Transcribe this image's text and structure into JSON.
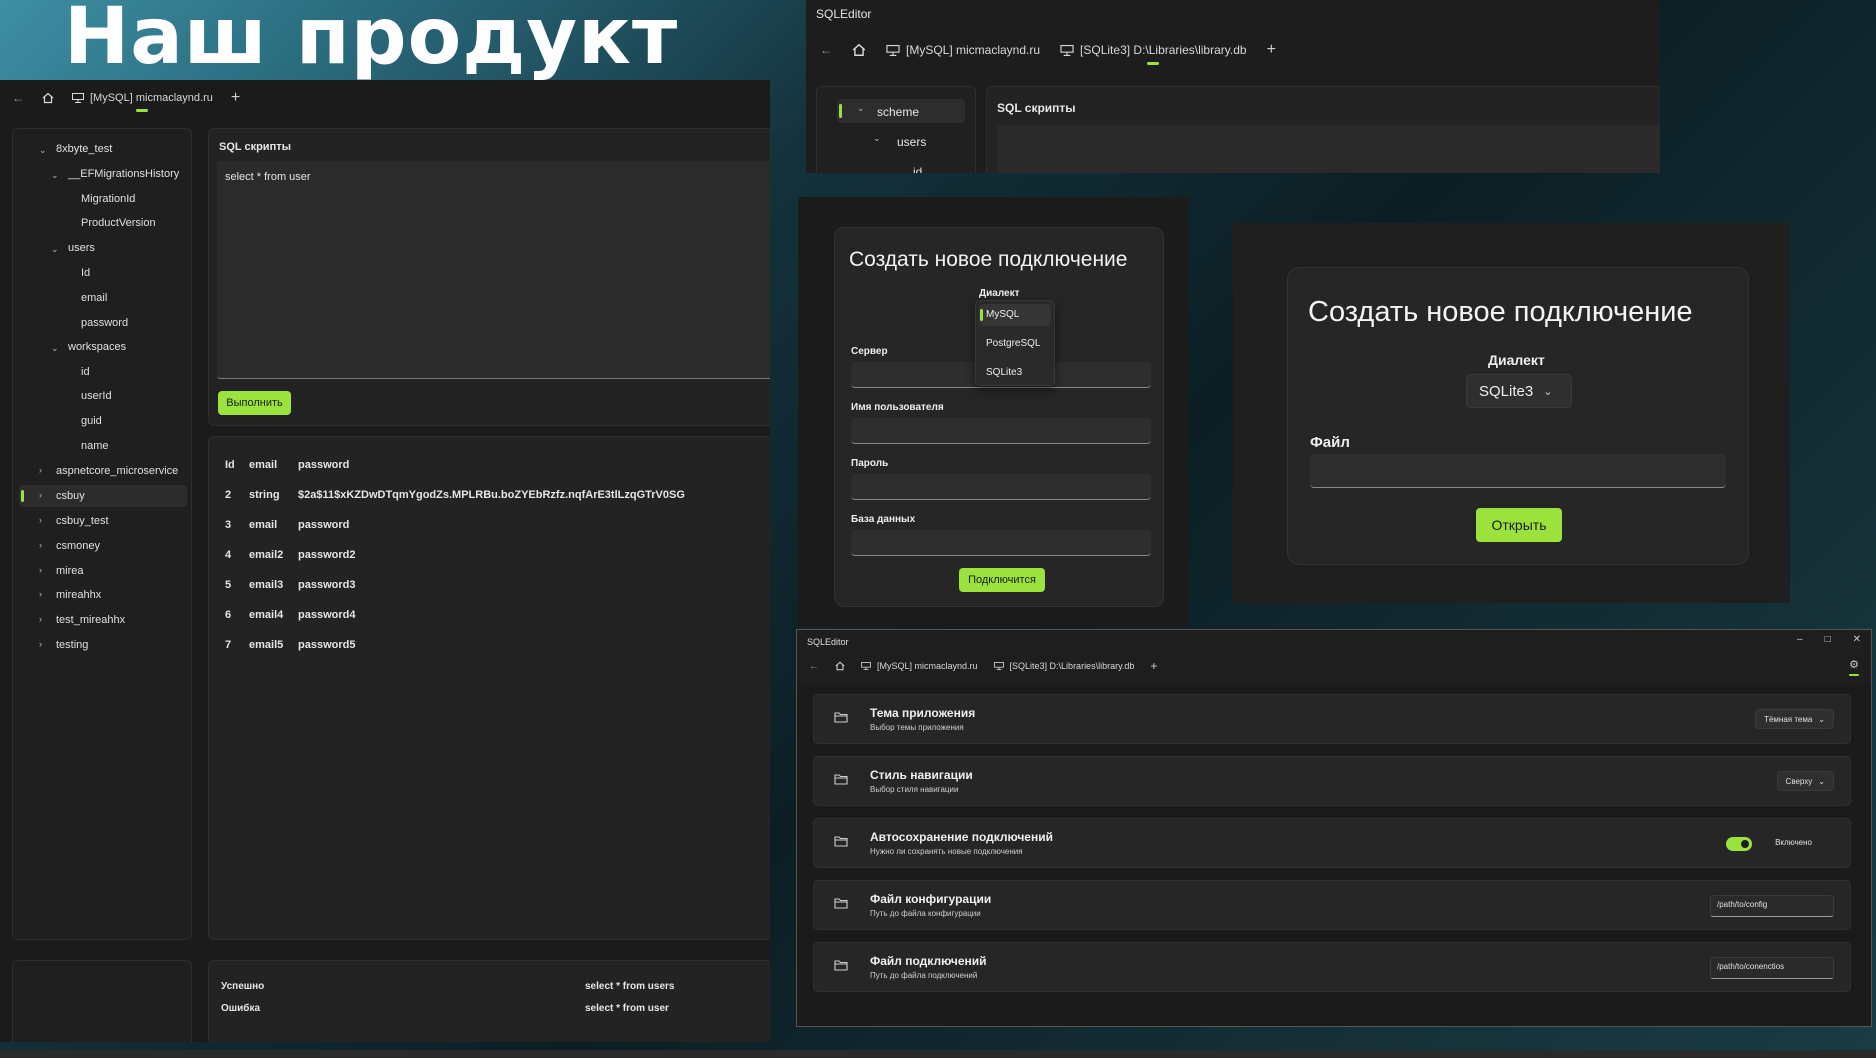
{
  "headline": "Наш продукт",
  "colors": {
    "accent": "#9be33c",
    "window_bg": "#1c1c1c",
    "panel_bg": "#232323"
  },
  "main_window": {
    "tabs": [
      {
        "label": "[MySQL] micmaclaynd.ru",
        "icon": "server-icon"
      }
    ],
    "tree": {
      "db1": "8xbyte_test",
      "t1": "__EFMigrationsHistory",
      "t1c1": "MigrationId",
      "t1c2": "ProductVersion",
      "t2": "users",
      "t2c1": "Id",
      "t2c2": "email",
      "t2c3": "password",
      "t3": "workspaces",
      "t3c1": "id",
      "t3c2": "userId",
      "t3c3": "guid",
      "t3c4": "name",
      "db2": "aspnetcore_microservice",
      "db3": "csbuy",
      "db4": "csbuy_test",
      "db5": "csmoney",
      "db6": "mirea",
      "db7": "mireahhx",
      "db8": "test_mireahhx",
      "db9": "testing"
    },
    "sql_title": "SQL скрипты",
    "sql_text": "select * from user",
    "run_button": "Выполнить",
    "results": {
      "headers": [
        "Id",
        "email",
        "password"
      ],
      "rows": [
        [
          "2",
          "string",
          "$2a$11$xKZDwDTqmYgodZs.MPLRBu.boZYEbRzfz.nqfArE3tlLzqGTrV0SG"
        ],
        [
          "3",
          "email",
          "password"
        ],
        [
          "4",
          "email2",
          "password2"
        ],
        [
          "5",
          "email3",
          "password3"
        ],
        [
          "6",
          "email4",
          "password4"
        ],
        [
          "7",
          "email5",
          "password5"
        ]
      ]
    },
    "log": [
      {
        "status": "Успешно",
        "query": "select * from users"
      },
      {
        "status": "Ошибка",
        "query": "select * from user"
      }
    ]
  },
  "top_window": {
    "title": "SQLEditor",
    "tabs": [
      {
        "label": "[MySQL] micmaclaynd.ru"
      },
      {
        "label": "[SQLite3] D:\\Libraries\\library.db"
      }
    ],
    "tree": {
      "n1": "scheme",
      "n2": "users",
      "n3": "id"
    },
    "sql_title": "SQL скрипты"
  },
  "dialog_mysql": {
    "title": "Создать новое подключение",
    "dialect_label": "Диалект",
    "options": [
      "MySQL",
      "PostgreSQL",
      "SQLite3"
    ],
    "selected": "MySQL",
    "server_label": "Сервер",
    "user_label": "Имя пользователя",
    "password_label": "Пароль",
    "db_label": "База данных",
    "connect_button": "Подключится"
  },
  "dialog_sqlite": {
    "title": "Создать новое подключение",
    "dialect_label": "Диалект",
    "dialect_value": "SQLite3",
    "file_label": "Файл",
    "open_button": "Открыть"
  },
  "settings_window": {
    "title": "SQLEditor",
    "tabs": [
      {
        "label": "[MySQL] micmaclaynd.ru"
      },
      {
        "label": "[SQLite3] D:\\Libraries\\library.db"
      }
    ],
    "rows": [
      {
        "title": "Тема приложения",
        "subtitle": "Выбор темы приложения",
        "value": "Тёмная тема"
      },
      {
        "title": "Стиль навигации",
        "subtitle": "Выбор стиля навигации",
        "value": "Сверху"
      },
      {
        "title": "Автосохранение подключений",
        "subtitle": "Нужно ли сохранять новые подключения",
        "value": "Включено",
        "toggle_on": true
      },
      {
        "title": "Файл конфигурации",
        "subtitle": "Путь до файла конфигурации",
        "value": "/path/to/config"
      },
      {
        "title": "Файл подключений",
        "subtitle": "Путь до файла подключений",
        "value": "/path/to/conenctios"
      }
    ]
  }
}
